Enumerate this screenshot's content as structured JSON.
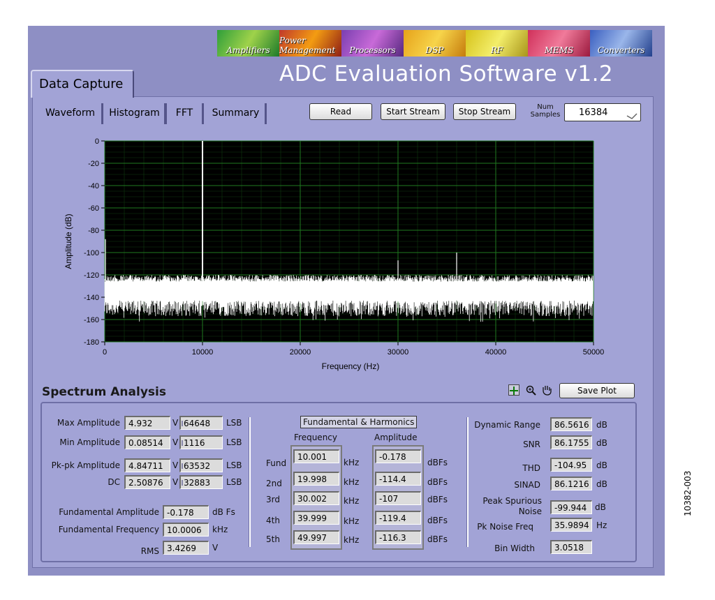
{
  "window": {
    "title": "ADC Evaluation Software v1.2",
    "main_tab": "Data Capture",
    "banner": [
      "Amplifiers",
      "Power Management",
      "Processors",
      "DSP",
      "RF",
      "MEMS",
      "Converters"
    ]
  },
  "subtabs": [
    {
      "label": "Waveform",
      "active": false
    },
    {
      "label": "Histogram",
      "active": false
    },
    {
      "label": "FFT",
      "active": true
    },
    {
      "label": "Summary",
      "active": false
    }
  ],
  "toolbar": {
    "read": "Read",
    "start_stream": "Start Stream",
    "stop_stream": "Stop Stream",
    "num_samples_label": "Num Samples",
    "num_samples_value": "16384"
  },
  "chart_data": {
    "type": "line",
    "xlabel": "Frequency (Hz)",
    "ylabel": "Amplitude (dB)",
    "xlim": [
      0,
      50000
    ],
    "ylim": [
      -180,
      0
    ],
    "xticks": [
      0,
      10000,
      20000,
      30000,
      40000,
      50000
    ],
    "yticks": [
      0,
      -20,
      -40,
      -60,
      -80,
      -100,
      -120,
      -140,
      -160,
      -180
    ],
    "grid": true,
    "noise_floor_db": [
      -120,
      -150
    ],
    "peaks": [
      {
        "x": 10001,
        "y": 0
      },
      {
        "x": 30002,
        "y": -107
      },
      {
        "x": 36000,
        "y": -100
      },
      {
        "x": 0,
        "y": -88
      }
    ]
  },
  "spectrum": {
    "title": "Spectrum Analysis",
    "save_plot": "Save Plot",
    "left": [
      {
        "label": "Max Amplitude",
        "v": "4.932",
        "vunit": "V",
        "lsb": "64648",
        "lunit": "LSB"
      },
      {
        "label": "Min Amplitude",
        "v": "0.08514",
        "vunit": "V",
        "lsb": "1116",
        "lunit": "LSB"
      },
      {
        "label": "Pk-pk Amplitude",
        "v": "4.84711",
        "vunit": "V",
        "lsb": "63532",
        "lunit": "LSB"
      },
      {
        "label": "DC",
        "v": "2.50876",
        "vunit": "V",
        "lsb": "32883",
        "lunit": "LSB"
      }
    ],
    "fund": [
      {
        "label": "Fundamental Amplitude",
        "v": "-0.178",
        "unit": "dB Fs"
      },
      {
        "label": "Fundamental Frequency",
        "v": "10.0006",
        "unit": "kHz"
      },
      {
        "label": "RMS",
        "v": "3.4269",
        "unit": "V"
      }
    ],
    "harmonics": {
      "title": "Fundamental & Harmonics",
      "freq_header": "Frequency",
      "amp_header": "Amplitude",
      "rows": [
        {
          "label": "Fund",
          "freq": "10.001",
          "funit": "kHz",
          "amp": "-0.178",
          "aunit": "dBFs"
        },
        {
          "label": "2nd",
          "freq": "19.998",
          "funit": "kHz",
          "amp": "-114.4",
          "aunit": "dBFs"
        },
        {
          "label": "3rd",
          "freq": "30.002",
          "funit": "kHz",
          "amp": "-107",
          "aunit": "dBFs"
        },
        {
          "label": "4th",
          "freq": "39.999",
          "funit": "kHz",
          "amp": "-119.4",
          "aunit": "dBFs"
        },
        {
          "label": "5th",
          "freq": "49.997",
          "funit": "kHz",
          "amp": "-116.3",
          "aunit": "dBFs"
        }
      ]
    },
    "right": [
      {
        "label": "Dynamic Range",
        "v": "86.5616",
        "unit": "dB"
      },
      {
        "label": "SNR",
        "v": "86.1755",
        "unit": "dB"
      },
      {
        "label": "THD",
        "v": "-104.95",
        "unit": "dB"
      },
      {
        "label": "SINAD",
        "v": "86.1216",
        "unit": "dB"
      },
      {
        "label": "Peak Spurious Noise",
        "v": "-99.944",
        "unit": "dB"
      },
      {
        "label": "Pk Noise Freq",
        "v": "35.9894",
        "unit": "Hz"
      },
      {
        "label": "Bin Width",
        "v": "3.0518",
        "unit": ""
      }
    ]
  },
  "doc_code": "10382-003"
}
